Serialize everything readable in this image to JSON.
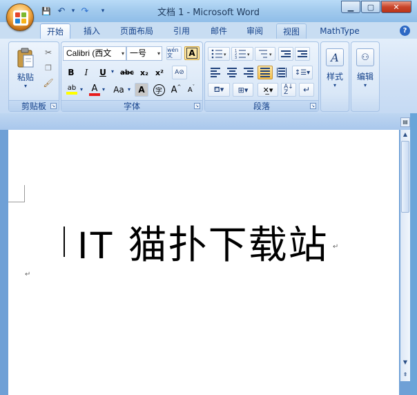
{
  "titlebar": {
    "title": "文档 1 - Microsoft Word",
    "qat": {
      "save": "💾",
      "undo": "↶",
      "undo_drop": "▾",
      "redo": "↷",
      "customize": "▾"
    },
    "minimize": "▁",
    "maximize": "▢",
    "close": "✕"
  },
  "tabs": [
    {
      "label": "开始"
    },
    {
      "label": "插入"
    },
    {
      "label": "页面布局"
    },
    {
      "label": "引用"
    },
    {
      "label": "邮件"
    },
    {
      "label": "审阅"
    },
    {
      "label": "视图"
    },
    {
      "label": "MathType"
    }
  ],
  "help": "?",
  "clipboard": {
    "paste": "粘贴",
    "label": "剪贴板"
  },
  "font": {
    "name": "Calibri (西文",
    "size": "一号",
    "label": "字体",
    "wen": "wén 文",
    "A": "A",
    "bold": "B",
    "italic": "I",
    "underline": "U",
    "strike": "abc",
    "sub": "x₂",
    "sup": "x²",
    "highlight": "ab",
    "color": "A",
    "case": "Aa",
    "shade": "A",
    "circle": "字",
    "grow": "A",
    "shrink": "A"
  },
  "paragraph": {
    "label": "段落"
  },
  "styles": {
    "label": "样式",
    "icon": "A"
  },
  "editing": {
    "label": "编辑",
    "icon": "🔍"
  },
  "document": {
    "text_latin": "IT",
    "text_cjk": " 猫扑下载站",
    "para_mark": "↵"
  },
  "colors": {
    "accent": "#15428b",
    "ribbon": "#d9e7f7",
    "frame": "#6aa5d9"
  }
}
